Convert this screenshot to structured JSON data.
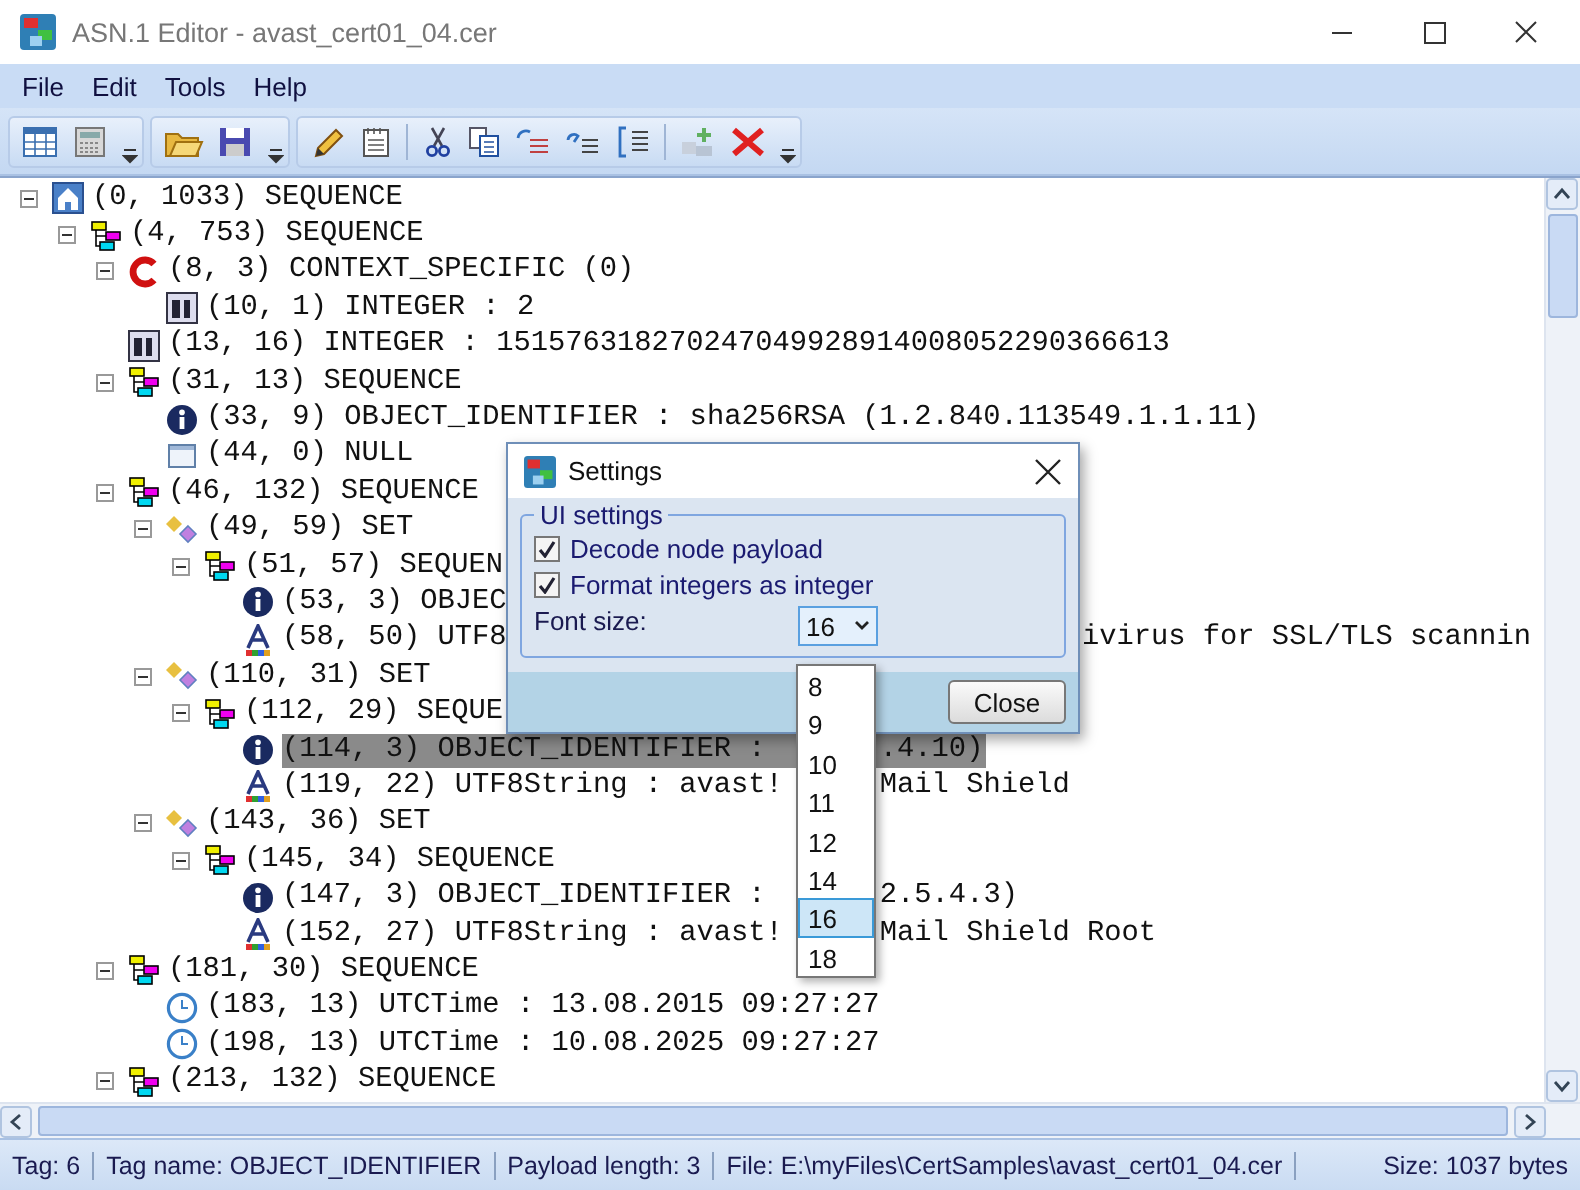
{
  "window": {
    "title": "ASN.1 Editor - avast_cert01_04.cer"
  },
  "menu": [
    {
      "label": "File"
    },
    {
      "label": "Edit"
    },
    {
      "label": "Tools"
    },
    {
      "label": "Help"
    }
  ],
  "tree": {
    "nodes": [
      {
        "text": "(0, 1033) SEQUENCE",
        "kind": "root",
        "expanded": true,
        "selected": false,
        "children": [
          {
            "text": "(4, 753) SEQUENCE",
            "kind": "sequence",
            "expanded": true,
            "selected": false,
            "children": [
              {
                "text": "(8, 3) CONTEXT_SPECIFIC (0)",
                "kind": "context",
                "expanded": true,
                "selected": false,
                "children": [
                  {
                    "text": "(10, 1) INTEGER : 2",
                    "kind": "integer",
                    "selected": false
                  }
                ]
              },
              {
                "text": "(13, 16) INTEGER : 151576318270247049928914008052290366613",
                "kind": "integer",
                "selected": false
              },
              {
                "text": "(31, 13) SEQUENCE",
                "kind": "sequence",
                "expanded": true,
                "selected": false,
                "children": [
                  {
                    "text": "(33, 9) OBJECT_IDENTIFIER : sha256RSA (1.2.840.113549.1.1.11)",
                    "kind": "oid",
                    "selected": false
                  },
                  {
                    "text": "(44, 0) NULL",
                    "kind": "null",
                    "selected": false
                  }
                ]
              },
              {
                "text": "(46, 132) SEQUENCE",
                "kind": "sequence",
                "expanded": true,
                "selected": false,
                "children": [
                  {
                    "text": "(49, 59) SET",
                    "kind": "set",
                    "expanded": true,
                    "selected": false,
                    "children": [
                      {
                        "text": "(51, 57) SEQUEN",
                        "kind": "sequence",
                        "expanded": true,
                        "selected": false,
                        "children": [
                          {
                            "text": "(53, 3) OBJEC",
                            "kind": "oid",
                            "selected": false
                          },
                          {
                            "text": "(58, 50) UTF8",
                            "tail": "ivirus for SSL/TLS scannin",
                            "under_list": false,
                            "kind": "utf8",
                            "selected": false
                          }
                        ]
                      }
                    ]
                  },
                  {
                    "text": "(110, 31) SET",
                    "kind": "set",
                    "expanded": true,
                    "selected": false,
                    "children": [
                      {
                        "text": "(112, 29) SEQUE",
                        "kind": "sequence",
                        "expanded": true,
                        "selected": false,
                        "children": [
                          {
                            "text": "(114, 3) OBJECT_IDENTIFIER :",
                            "tail": ".4.10)",
                            "under_list": true,
                            "kind": "oid",
                            "selected": true
                          },
                          {
                            "text": "(119, 22) UTF8String : avast!",
                            "tail": "Mail Shield",
                            "under_list": true,
                            "kind": "utf8",
                            "selected": false
                          }
                        ]
                      }
                    ]
                  },
                  {
                    "text": "(143, 36) SET",
                    "kind": "set",
                    "expanded": true,
                    "selected": false,
                    "children": [
                      {
                        "text": "(145, 34) SEQUENCE",
                        "kind": "sequence",
                        "expanded": true,
                        "selected": false,
                        "children": [
                          {
                            "text": "(147, 3) OBJECT_IDENTIFIER :",
                            "tail": "2.5.4.3)",
                            "under_list": true,
                            "kind": "oid",
                            "selected": false
                          },
                          {
                            "text": "(152, 27) UTF8String : avast!",
                            "tail": "Mail Shield Root",
                            "under_list": true,
                            "kind": "utf8",
                            "selected": false
                          }
                        ]
                      }
                    ]
                  }
                ]
              },
              {
                "text": "(181, 30) SEQUENCE",
                "kind": "sequence",
                "expanded": true,
                "selected": false,
                "children": [
                  {
                    "text": "(183, 13) UTCTime : 13.08.2015 09:27:27",
                    "kind": "time",
                    "selected": false
                  },
                  {
                    "text": "(198, 13) UTCTime : 10.08.2025 09:27:27",
                    "kind": "time",
                    "selected": false
                  }
                ]
              },
              {
                "text": "(213, 132) SEQUENCE",
                "kind": "sequence",
                "expanded": true,
                "selected": false
              }
            ]
          }
        ]
      }
    ]
  },
  "dialog": {
    "title": "Settings",
    "group": "UI settings",
    "options": [
      {
        "label": "Decode node payload",
        "checked": true
      },
      {
        "label": "Format integers as integer",
        "checked": true
      }
    ],
    "font_size": {
      "label": "Font size:",
      "value": "16",
      "open": true,
      "options": [
        {
          "label": "8",
          "selected": false
        },
        {
          "label": "9",
          "selected": false
        },
        {
          "label": "10",
          "selected": false
        },
        {
          "label": "11",
          "selected": false
        },
        {
          "label": "12",
          "selected": false
        },
        {
          "label": "14",
          "selected": false
        },
        {
          "label": "16",
          "selected": true
        },
        {
          "label": "18",
          "selected": false
        }
      ]
    },
    "close": "Close"
  },
  "status_bar": [
    {
      "text": "Tag: 6"
    },
    {
      "text": "Tag name: OBJECT_IDENTIFIER"
    },
    {
      "text": "Payload length: 3"
    },
    {
      "text": "File: E:\\myFiles\\CertSamples\\avast_cert01_04.cer"
    },
    {
      "text": "Size: 1037 bytes"
    }
  ]
}
